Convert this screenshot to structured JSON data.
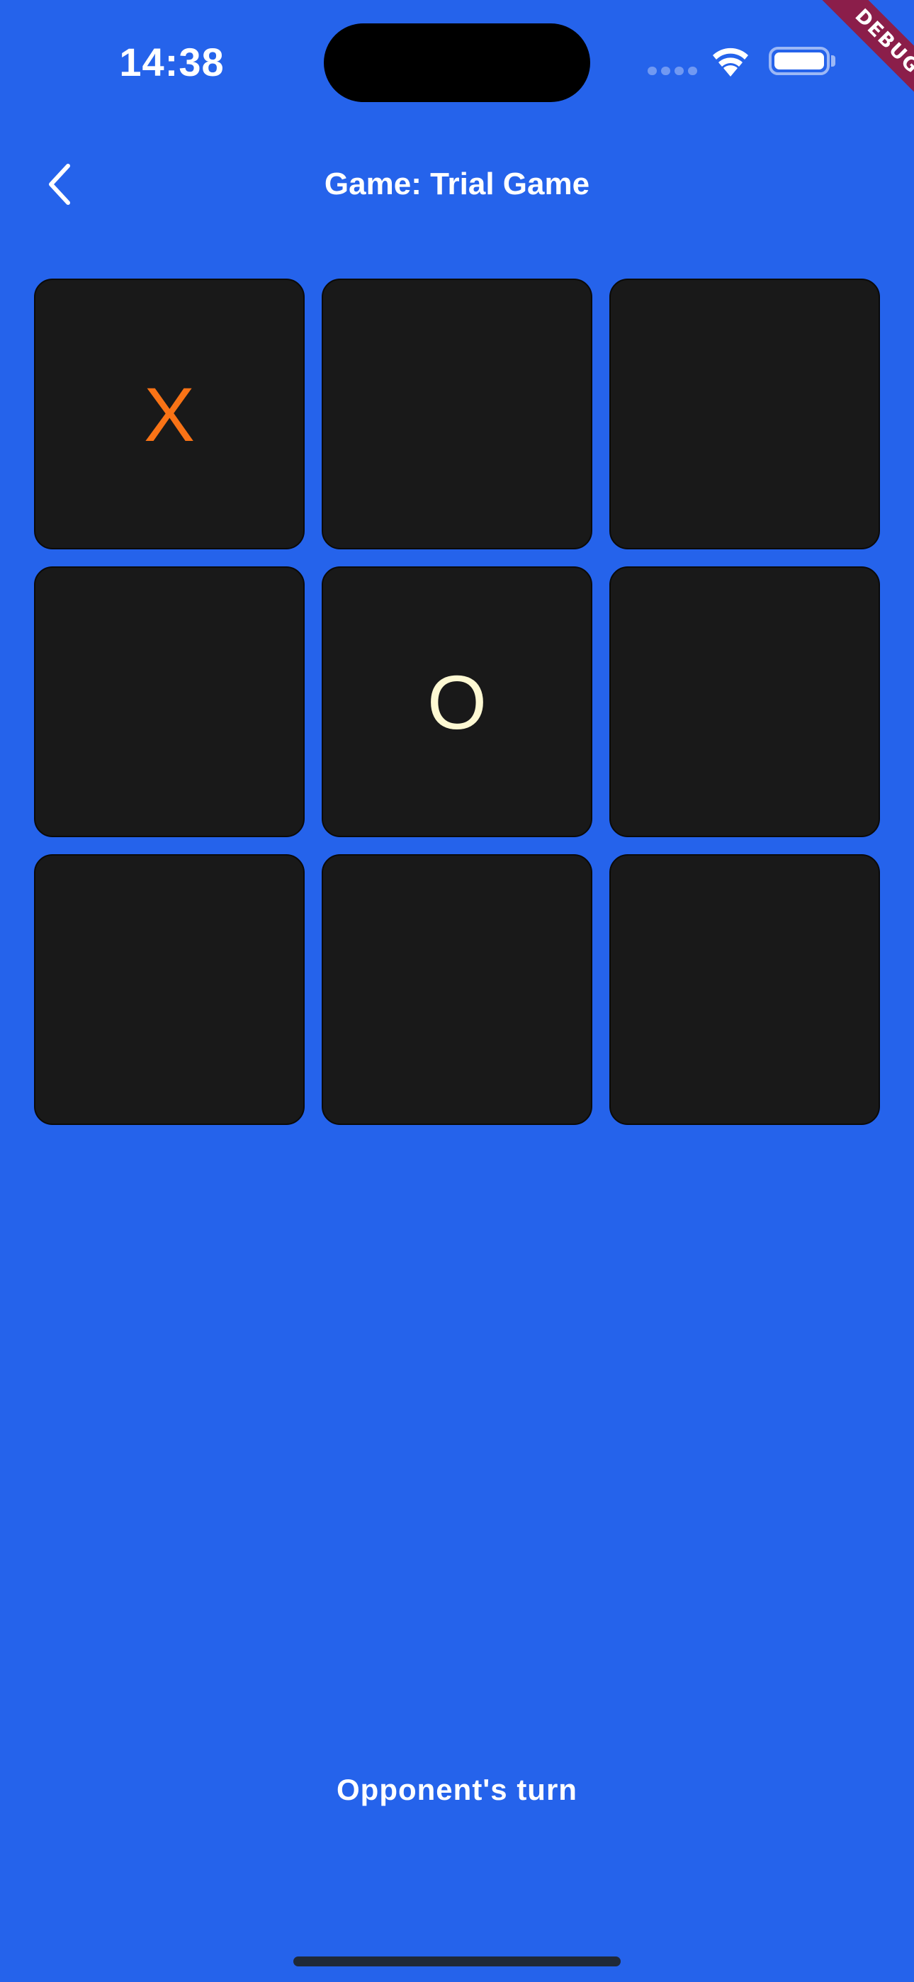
{
  "status_bar": {
    "time": "14:38"
  },
  "debug_banner": {
    "label": "DEBUG",
    "color": "#8B1E4A"
  },
  "app_bar": {
    "back_icon": "chevron-left-icon",
    "title": "Game: Trial Game"
  },
  "board": {
    "cells": [
      "X",
      "",
      "",
      "",
      "O",
      "",
      "",
      "",
      ""
    ],
    "cell_color": "#191919",
    "x_color": "#F97316",
    "o_color": "#FEF9D3"
  },
  "status": {
    "turn_text": "Opponent's turn"
  },
  "theme": {
    "background": "#2563EB"
  }
}
